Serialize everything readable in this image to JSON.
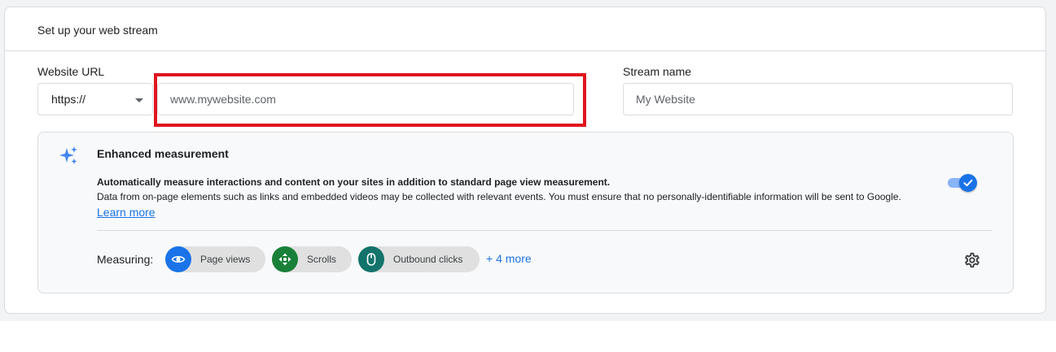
{
  "card": {
    "title": "Set up your web stream"
  },
  "website_url": {
    "label": "Website URL",
    "protocol_value": "https://",
    "url_placeholder": "www.mywebsite.com"
  },
  "stream_name": {
    "label": "Stream name",
    "placeholder": "My Website"
  },
  "enhanced_measurement": {
    "title": "Enhanced measurement",
    "description": "Automatically measure interactions and content on your sites in addition to standard page view measurement.",
    "note": "Data from on-page elements such as links and embedded videos may be collected with relevant events. You must ensure that no personally-identifiable information will be sent to Google.",
    "learn_more": "Learn more",
    "enabled": true,
    "measuring_label": "Measuring:",
    "chips": [
      {
        "label": "Page views",
        "icon": "eye-icon",
        "color": "#1a73e8"
      },
      {
        "label": "Scrolls",
        "icon": "scroll-arrows-icon",
        "color": "#188038"
      },
      {
        "label": "Outbound clicks",
        "icon": "mouse-icon",
        "color": "#12736b"
      }
    ],
    "more_link": "+ 4 more"
  },
  "colors": {
    "accent": "#1a73e8",
    "highlight": "#e0141e",
    "border": "#dadce0"
  }
}
